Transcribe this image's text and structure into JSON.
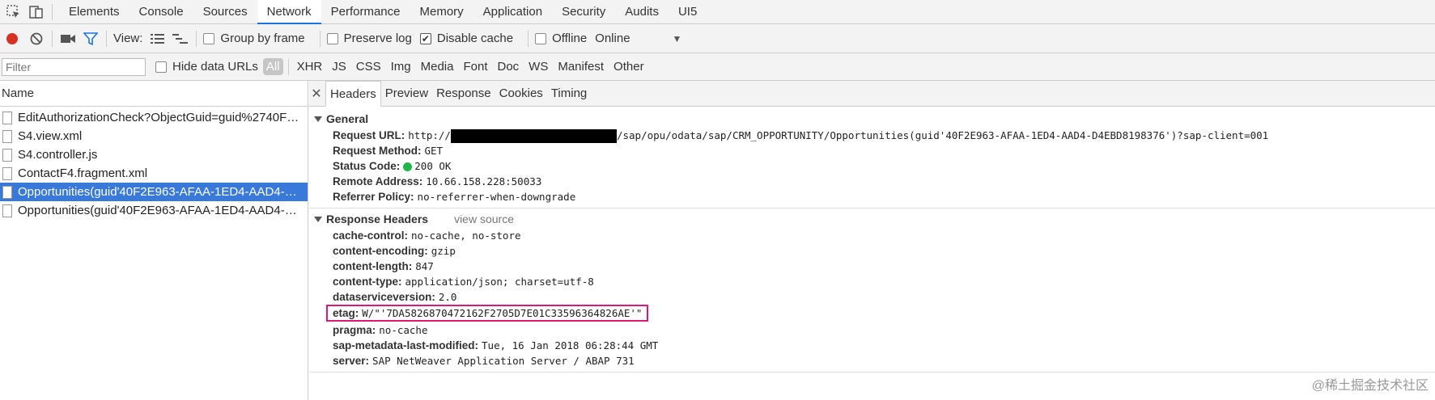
{
  "main_tabs": [
    "Elements",
    "Console",
    "Sources",
    "Network",
    "Performance",
    "Memory",
    "Application",
    "Security",
    "Audits",
    "UI5"
  ],
  "active_tab": "Network",
  "toolbar": {
    "view_label": "View:",
    "group_by_frame": "Group by frame",
    "preserve_log": "Preserve log",
    "disable_cache": "Disable cache",
    "offline": "Offline",
    "throttle": "Online"
  },
  "filter": {
    "placeholder": "Filter",
    "hide_data_urls": "Hide data URLs",
    "types": [
      "All",
      "XHR",
      "JS",
      "CSS",
      "Img",
      "Media",
      "Font",
      "Doc",
      "WS",
      "Manifest",
      "Other"
    ]
  },
  "requests": {
    "header": "Name",
    "items": [
      "EditAuthorizationCheck?ObjectGuid=guid%2740F2E963-A...",
      "S4.view.xml",
      "S4.controller.js",
      "ContactF4.fragment.xml",
      "Opportunities(guid'40F2E963-AFAA-1ED4-AAD4-D4EBD81...",
      "Opportunities(guid'40F2E963-AFAA-1ED4-AAD4-D4EBD81..."
    ],
    "selected_index": 4
  },
  "detail_tabs": [
    "Headers",
    "Preview",
    "Response",
    "Cookies",
    "Timing"
  ],
  "general": {
    "title": "General",
    "request_url_label": "Request URL:",
    "request_url_prefix": "http://",
    "request_url_suffix": "/sap/opu/odata/sap/CRM_OPPORTUNITY/Opportunities(guid'40F2E963-AFAA-1ED4-AAD4-D4EBD8198376')?sap-client=001",
    "request_method_label": "Request Method:",
    "request_method": "GET",
    "status_code_label": "Status Code:",
    "status_code": "200 OK",
    "remote_address_label": "Remote Address:",
    "remote_address": "10.66.158.228:50033",
    "referrer_policy_label": "Referrer Policy:",
    "referrer_policy": "no-referrer-when-downgrade"
  },
  "response_headers": {
    "title": "Response Headers",
    "view_source": "view source",
    "rows": [
      {
        "k": "cache-control:",
        "v": "no-cache, no-store"
      },
      {
        "k": "content-encoding:",
        "v": "gzip"
      },
      {
        "k": "content-length:",
        "v": "847"
      },
      {
        "k": "content-type:",
        "v": "application/json; charset=utf-8"
      },
      {
        "k": "dataserviceversion:",
        "v": "2.0"
      },
      {
        "k": "etag:",
        "v": "W/\"'7DA5826870472162F2705D7E01C33596364826AE'\""
      },
      {
        "k": "pragma:",
        "v": "no-cache"
      },
      {
        "k": "sap-metadata-last-modified:",
        "v": "Tue, 16 Jan 2018 06:28:44 GMT"
      },
      {
        "k": "server:",
        "v": "SAP NetWeaver Application Server / ABAP 731"
      }
    ]
  },
  "colors": {
    "accent": "#1a73e8",
    "selection": "#3879d9",
    "record": "#d93025",
    "status_ok": "#1fb74a",
    "highlight_box": "#d81b75"
  },
  "watermark": "@稀土掘金技术社区"
}
